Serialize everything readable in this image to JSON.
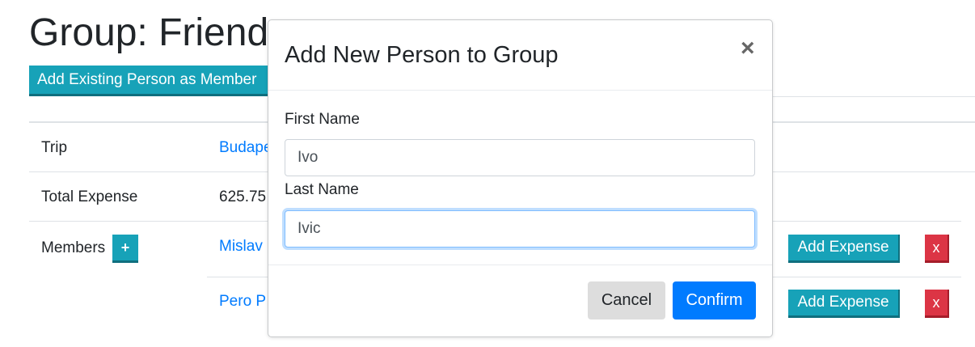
{
  "page": {
    "title": "Group: Friends",
    "add_existing_label": "Add Existing Person as Member"
  },
  "table": {
    "trip_label": "Trip",
    "trip_value": "Budapest",
    "total_label": "Total Expense",
    "total_value": "625.75",
    "members_label": "Members",
    "add_member_label": "+",
    "members": [
      {
        "name": "Mislav",
        "add_expense_label": "Add Expense",
        "remove_label": "x"
      },
      {
        "name": "Pero P",
        "add_expense_label": "Add Expense",
        "remove_label": "x"
      }
    ]
  },
  "modal": {
    "title": "Add New Person to Group",
    "close_icon": "close-icon",
    "first_name_label": "First Name",
    "first_name_value": "Ivo",
    "last_name_label": "Last Name",
    "last_name_value": "Ivic",
    "cancel_label": "Cancel",
    "confirm_label": "Confirm"
  },
  "colors": {
    "info": "#17a2b8",
    "danger": "#dc3545",
    "primary": "#007bff",
    "cancel_bg": "#dddddd",
    "link": "#007bff"
  }
}
